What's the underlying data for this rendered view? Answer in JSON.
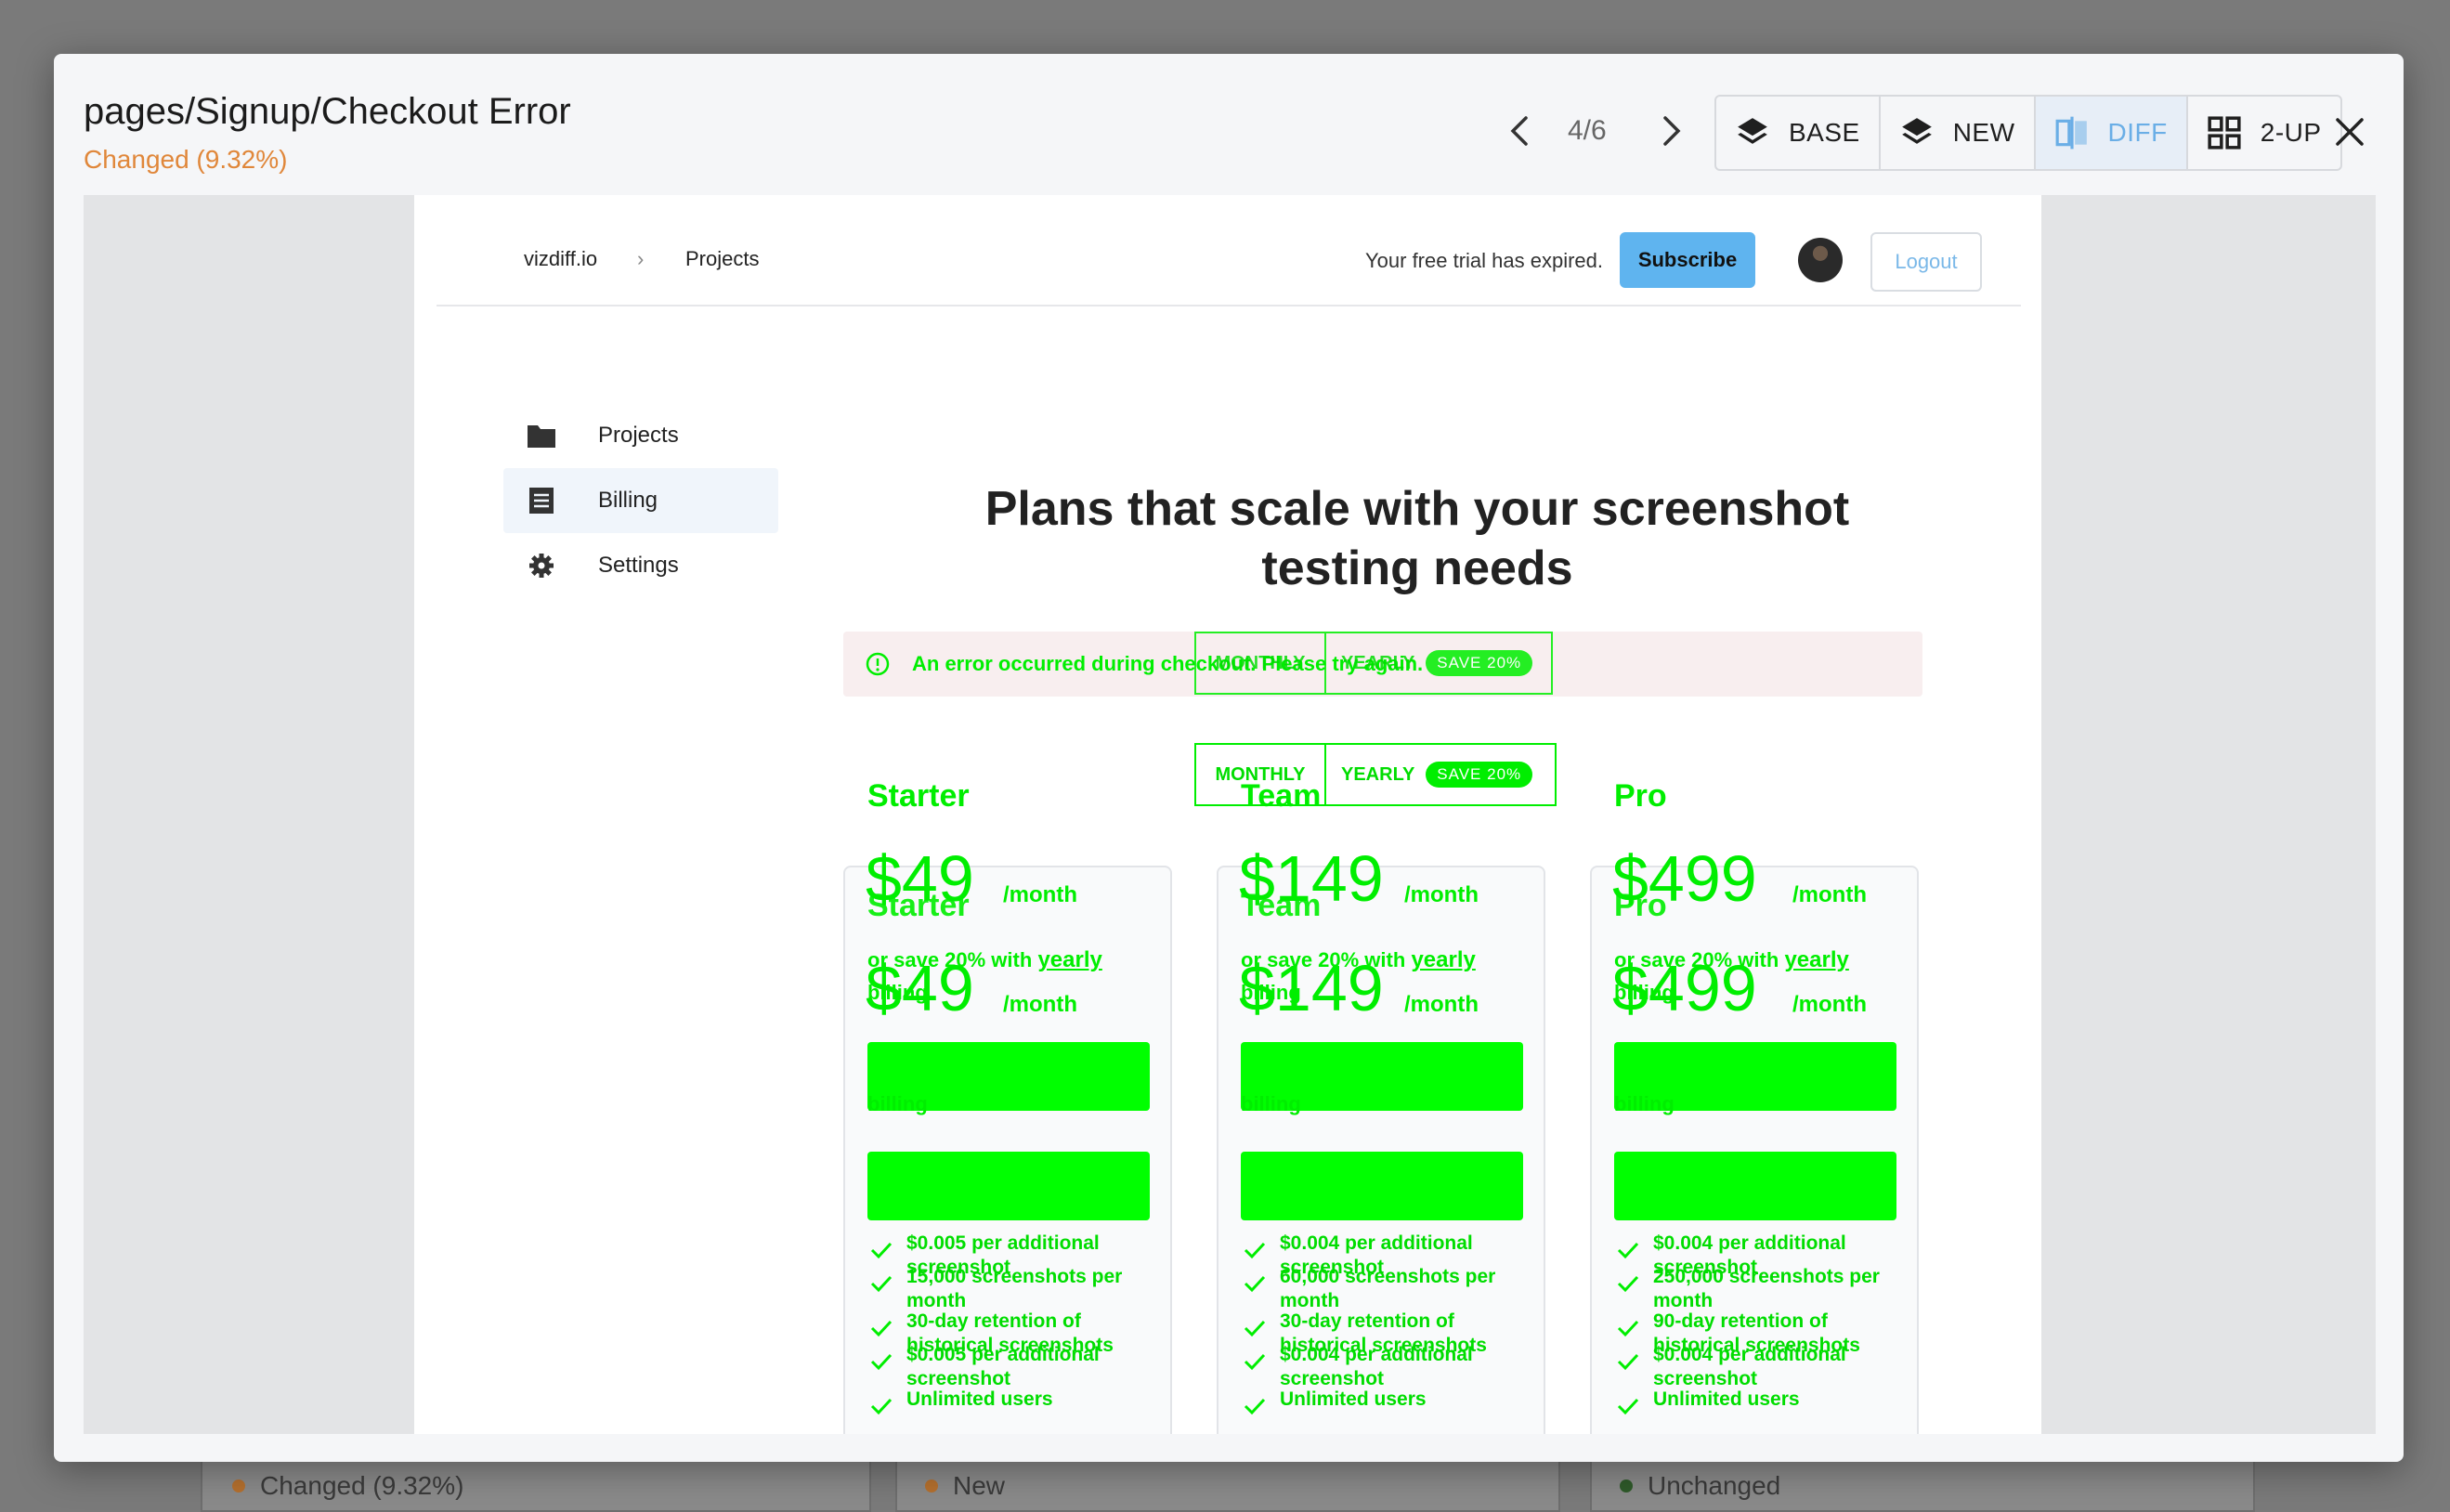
{
  "modal": {
    "title": "pages/Signup/Checkout Error",
    "status": "Changed (9.32%)",
    "counter": "4/6",
    "views": [
      {
        "label": "BASE",
        "icon": "layers-icon"
      },
      {
        "label": "NEW",
        "icon": "layers-icon"
      },
      {
        "label": "DIFF",
        "icon": "diff-icon",
        "active": true
      },
      {
        "label": "2-UP",
        "icon": "grid-icon"
      }
    ]
  },
  "background_cards": [
    {
      "status": "Changed (9.32%)",
      "dot": "#b5702e"
    },
    {
      "status": "New",
      "dot": "#b5702e"
    },
    {
      "status": "Unchanged",
      "dot": "#2f5a2a"
    }
  ],
  "app": {
    "brand": "vizdiff.io",
    "separator": "›",
    "crumb": "Projects",
    "trial_text": "Your free trial has expired.",
    "subscribe": "Subscribe",
    "logout": "Logout"
  },
  "sidebar": [
    {
      "label": "Projects",
      "icon": "folder-icon"
    },
    {
      "label": "Billing",
      "icon": "receipt-icon",
      "active": true
    },
    {
      "label": "Settings",
      "icon": "gear-icon"
    }
  ],
  "heading": {
    "line1": "Plans that scale with your screenshot",
    "line2": "testing needs"
  },
  "error": {
    "text": "An error occurred during checkout. Please try again."
  },
  "toggle": {
    "monthly": "MONTHLY",
    "yearly": "YEARLY",
    "save": "SAVE 20%"
  },
  "plans": [
    {
      "name": "Starter",
      "price": "$49",
      "per": "/month",
      "note_prefix": "or save 20% with",
      "note_link": "yearly",
      "note_tail": "billing",
      "features": [
        "$0.005 per additional screenshot",
        "15,000 screenshots per month",
        "30-day retention of historical screenshots",
        "Unlimited users"
      ]
    },
    {
      "name": "Team",
      "price": "$149",
      "per": "/month",
      "note_prefix": "or save 20% with",
      "note_link": "yearly",
      "note_tail": "billing",
      "features": [
        "$0.004 per additional screenshot",
        "60,000 screenshots per month",
        "30-day retention of historical screenshots",
        "Unlimited users"
      ]
    },
    {
      "name": "Pro",
      "price": "$499",
      "per": "/month",
      "note_prefix": "or save 20% with",
      "note_link": "yearly",
      "note_tail": "billing",
      "features": [
        "$0.004 per additional screenshot",
        "250,000 screenshots per month",
        "90-day retention of historical screenshots",
        "Unlimited users"
      ]
    }
  ],
  "colors": {
    "diff_highlight": "#00ee00",
    "status_changed": "#e0873a",
    "accent": "#5fb4ef"
  }
}
